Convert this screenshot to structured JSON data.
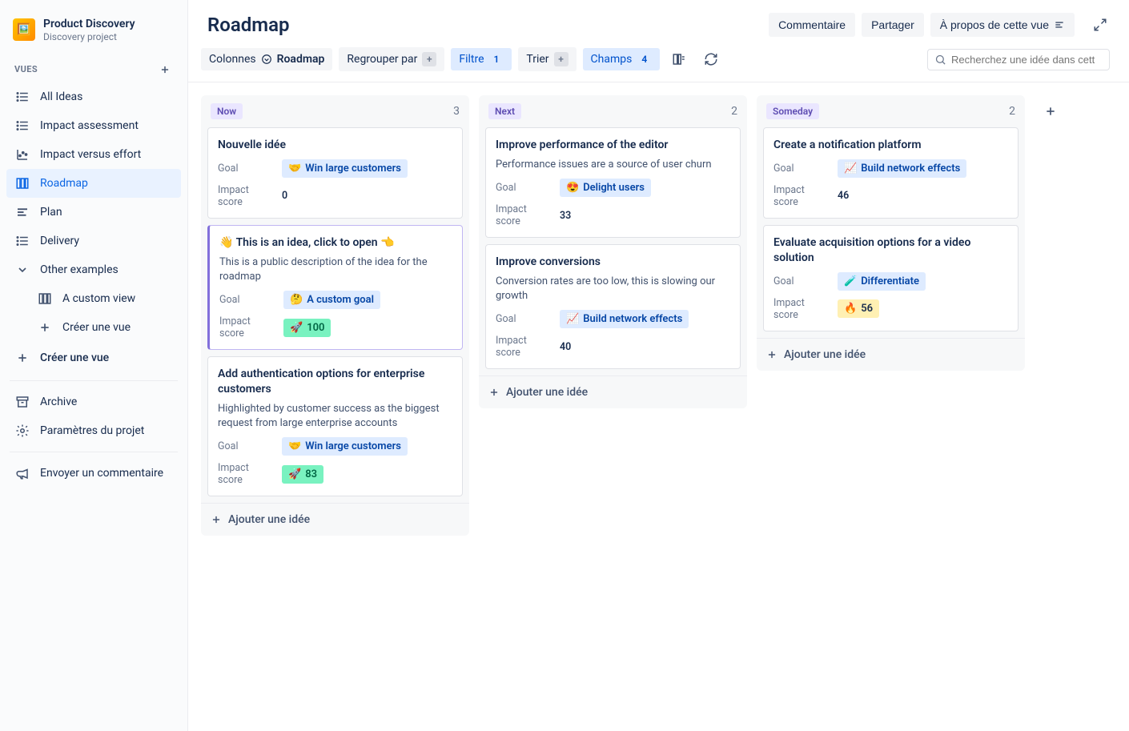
{
  "project": {
    "name": "Product Discovery",
    "subtitle": "Discovery project"
  },
  "sidebar": {
    "section_label": "VUES",
    "items": [
      {
        "label": "All Ideas",
        "icon": "list"
      },
      {
        "label": "Impact assessment",
        "icon": "list"
      },
      {
        "label": "Impact versus effort",
        "icon": "chart"
      },
      {
        "label": "Roadmap",
        "icon": "board",
        "active": true
      },
      {
        "label": "Plan",
        "icon": "align"
      },
      {
        "label": "Delivery",
        "icon": "list"
      },
      {
        "label": "Other examples",
        "icon": "chevron",
        "children": [
          {
            "label": "A custom view",
            "icon": "board"
          },
          {
            "label": "Créer une vue",
            "icon": "plus"
          }
        ]
      }
    ],
    "create_view": "Créer une vue",
    "footer": [
      {
        "label": "Archive",
        "icon": "archive"
      },
      {
        "label": "Paramètres du projet",
        "icon": "gear"
      },
      {
        "label": "Envoyer un commentaire",
        "icon": "megaphone"
      }
    ]
  },
  "header": {
    "title": "Roadmap",
    "actions": {
      "comment": "Commentaire",
      "share": "Partager",
      "about": "À propos de cette vue"
    }
  },
  "filters": {
    "columns_label": "Colonnes",
    "columns_value": "Roadmap",
    "group_by": "Regrouper par",
    "filter_label": "Filtre",
    "filter_count": "1",
    "sort": "Trier",
    "fields_label": "Champs",
    "fields_count": "4",
    "search_placeholder": "Recherchez une idée dans cett"
  },
  "board": {
    "add_card_label": "Ajouter une idée",
    "columns": [
      {
        "name": "Now",
        "count": "3",
        "badge_bg": "#EAE6FF",
        "badge_fg": "#5E4DB2",
        "cards": [
          {
            "title": "Nouvelle idée",
            "fields": [
              {
                "label": "Goal",
                "tag": {
                  "emoji": "🤝",
                  "text": "Win large customers",
                  "cls": "tag-blue"
                }
              },
              {
                "label": "Impact score",
                "value": "0"
              }
            ]
          },
          {
            "title": "👋 This is an idea, click to open 👈",
            "highlight": true,
            "desc": "This is a public description of the idea for the roadmap",
            "fields": [
              {
                "label": "Goal",
                "tag": {
                  "emoji": "🤔",
                  "text": "A custom goal",
                  "cls": "tag-blue"
                }
              },
              {
                "label": "Impact score",
                "tag": {
                  "emoji": "🚀",
                  "text": "100",
                  "cls": "tag-green"
                }
              }
            ]
          },
          {
            "title": "Add authentication options for enterprise customers",
            "desc": "Highlighted by customer success as the biggest request from large enterprise accounts",
            "fields": [
              {
                "label": "Goal",
                "tag": {
                  "emoji": "🤝",
                  "text": "Win large customers",
                  "cls": "tag-blue"
                }
              },
              {
                "label": "Impact score",
                "tag": {
                  "emoji": "🚀",
                  "text": "83",
                  "cls": "tag-green"
                }
              }
            ]
          }
        ]
      },
      {
        "name": "Next",
        "count": "2",
        "badge_bg": "#EAE6FF",
        "badge_fg": "#5E4DB2",
        "cards": [
          {
            "title": "Improve performance of the editor",
            "desc": "Performance issues are a source of user churn",
            "fields": [
              {
                "label": "Goal",
                "tag": {
                  "emoji": "😍",
                  "text": "Delight users",
                  "cls": "tag-blue"
                }
              },
              {
                "label": "Impact score",
                "value": "33"
              }
            ]
          },
          {
            "title": "Improve conversions",
            "desc": "Conversion rates are too low, this is slowing our growth",
            "fields": [
              {
                "label": "Goal",
                "tag": {
                  "emoji": "📈",
                  "text": "Build network effects",
                  "cls": "tag-blue"
                }
              },
              {
                "label": "Impact score",
                "value": "40"
              }
            ]
          }
        ]
      },
      {
        "name": "Someday",
        "count": "2",
        "badge_bg": "#EAE6FF",
        "badge_fg": "#5E4DB2",
        "cards": [
          {
            "title": "Create a notification platform",
            "fields": [
              {
                "label": "Goal",
                "tag": {
                  "emoji": "📈",
                  "text": "Build network effects",
                  "cls": "tag-blue"
                }
              },
              {
                "label": "Impact score",
                "value": "46"
              }
            ]
          },
          {
            "title": "Evaluate acquisition options for a video solution",
            "fields": [
              {
                "label": "Goal",
                "tag": {
                  "emoji": "🧪",
                  "text": "Differentiate",
                  "cls": "tag-blue"
                }
              },
              {
                "label": "Impact score",
                "tag": {
                  "emoji": "🔥",
                  "text": "56",
                  "cls": "tag-yellow"
                }
              }
            ]
          }
        ]
      }
    ]
  }
}
